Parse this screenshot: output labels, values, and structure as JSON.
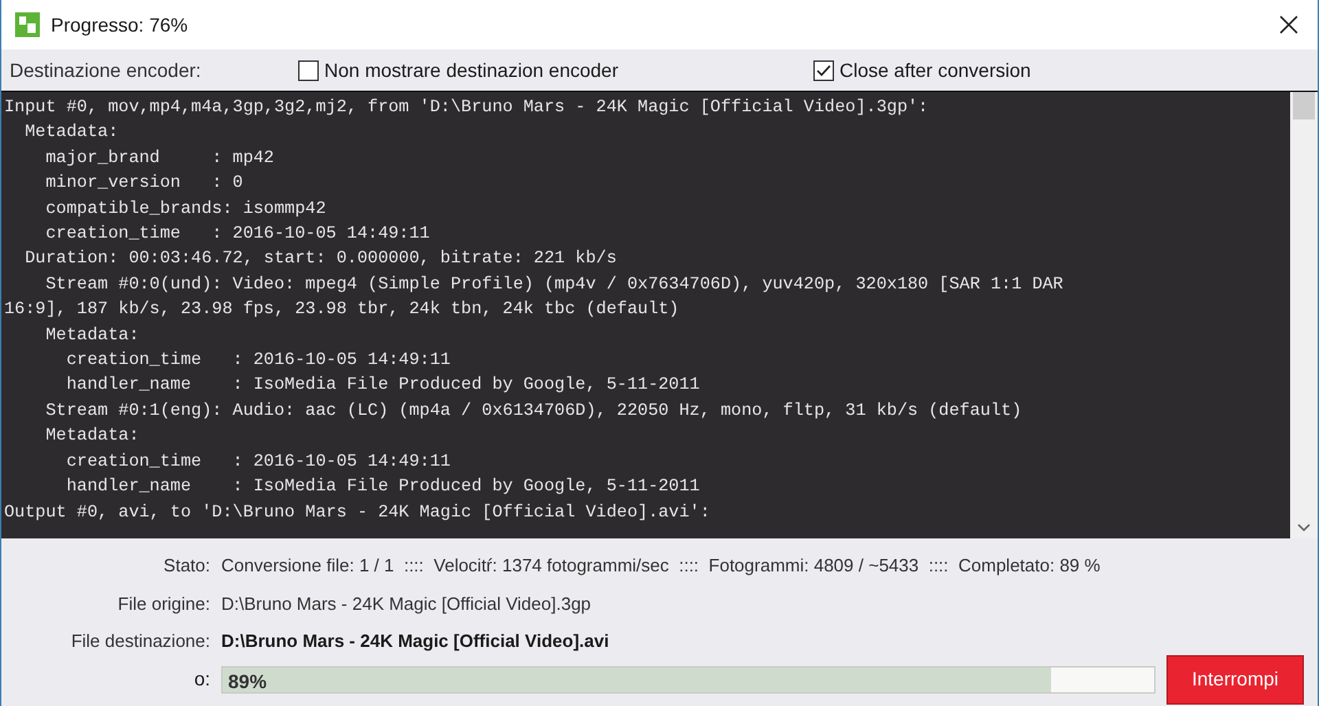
{
  "window": {
    "title": "Progresso: 76%"
  },
  "options": {
    "label": "Destinazione encoder:",
    "checkboxes": [
      {
        "label": "Non mostrare destinazion encoder",
        "checked": false
      },
      {
        "label": "Close after conversion",
        "checked": true
      }
    ]
  },
  "console": {
    "lines": [
      "Input #0, mov,mp4,m4a,3gp,3g2,mj2, from 'D:\\Bruno Mars - 24K Magic [Official Video].3gp':",
      "  Metadata:",
      "    major_brand     : mp42",
      "    minor_version   : 0",
      "    compatible_brands: isommp42",
      "    creation_time   : 2016-10-05 14:49:11",
      "  Duration: 00:03:46.72, start: 0.000000, bitrate: 221 kb/s",
      "    Stream #0:0(und): Video: mpeg4 (Simple Profile) (mp4v / 0x7634706D), yuv420p, 320x180 [SAR 1:1 DAR",
      "16:9], 187 kb/s, 23.98 fps, 23.98 tbr, 24k tbn, 24k tbc (default)",
      "    Metadata:",
      "      creation_time   : 2016-10-05 14:49:11",
      "      handler_name    : IsoMedia File Produced by Google, 5-11-2011",
      "    Stream #0:1(eng): Audio: aac (LC) (mp4a / 0x6134706D), 22050 Hz, mono, fltp, 31 kb/s (default)",
      "    Metadata:",
      "      creation_time   : 2016-10-05 14:49:11",
      "      handler_name    : IsoMedia File Produced by Google, 5-11-2011",
      "Output #0, avi, to 'D:\\Bruno Mars - 24K Magic [Official Video].avi':"
    ]
  },
  "info": [
    {
      "label": "Stato:",
      "value": "Conversione file: 1 / 1  ::::  Velocitŕ: 1374 fotogrammi/sec  ::::  Fotogrammi: 4809 / ~5433  ::::  Completato: 89 %",
      "bold": false
    },
    {
      "label": "File origine:",
      "value": "D:\\Bruno Mars - 24K Magic [Official Video].3gp",
      "bold": false
    },
    {
      "label": "File destinazione:",
      "value": "D:\\Bruno Mars - 24K Magic [Official Video].avi",
      "bold": true
    }
  ],
  "progress": {
    "label": "o:",
    "level": 0.89,
    "text": "89%"
  },
  "stop_button": "Interrompi"
}
